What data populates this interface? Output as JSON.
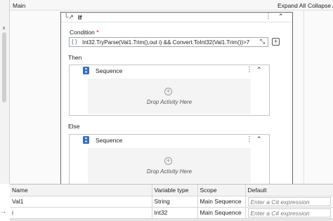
{
  "topbar": {
    "breadcrumb": "Main",
    "expand_all": "Expand All",
    "collapse_all": "Collapse All"
  },
  "if_activity": {
    "title": "If",
    "condition_label": "Condition",
    "required_marker": "*",
    "condition_value": "Int32.TryParse(Val1.Trim(),out i) && Convert.ToInt32(Val1.Trim())>7",
    "then_label": "Then",
    "else_label": "Else"
  },
  "sequences": {
    "then": {
      "title": "Sequence",
      "drop_text": "Drop Activity Here"
    },
    "else": {
      "title": "Sequence",
      "drop_text": "Drop Activity Here"
    }
  },
  "variables": {
    "columns": [
      "Name",
      "Variable type",
      "Scope",
      "Default"
    ],
    "rows": [
      {
        "name": "Val1",
        "type": "String",
        "scope": "Main Sequence",
        "default_placeholder": "Enter a C# expression"
      },
      {
        "name": "i",
        "type": "Int32",
        "scope": "Main Sequence",
        "default_placeholder": "Enter a C# expression"
      }
    ]
  },
  "colors": {
    "required": "#cc0000",
    "braces": "#3d6fb6",
    "indicator": "#dd3333"
  },
  "icons": [
    "chevron-up-icon",
    "if-activity-icon",
    "kebab-menu-icon",
    "collapse-chevrons-icon",
    "braces-icon",
    "expand-editor-icon",
    "plus-icon",
    "sequence-icon",
    "arrow-right-icon"
  ]
}
